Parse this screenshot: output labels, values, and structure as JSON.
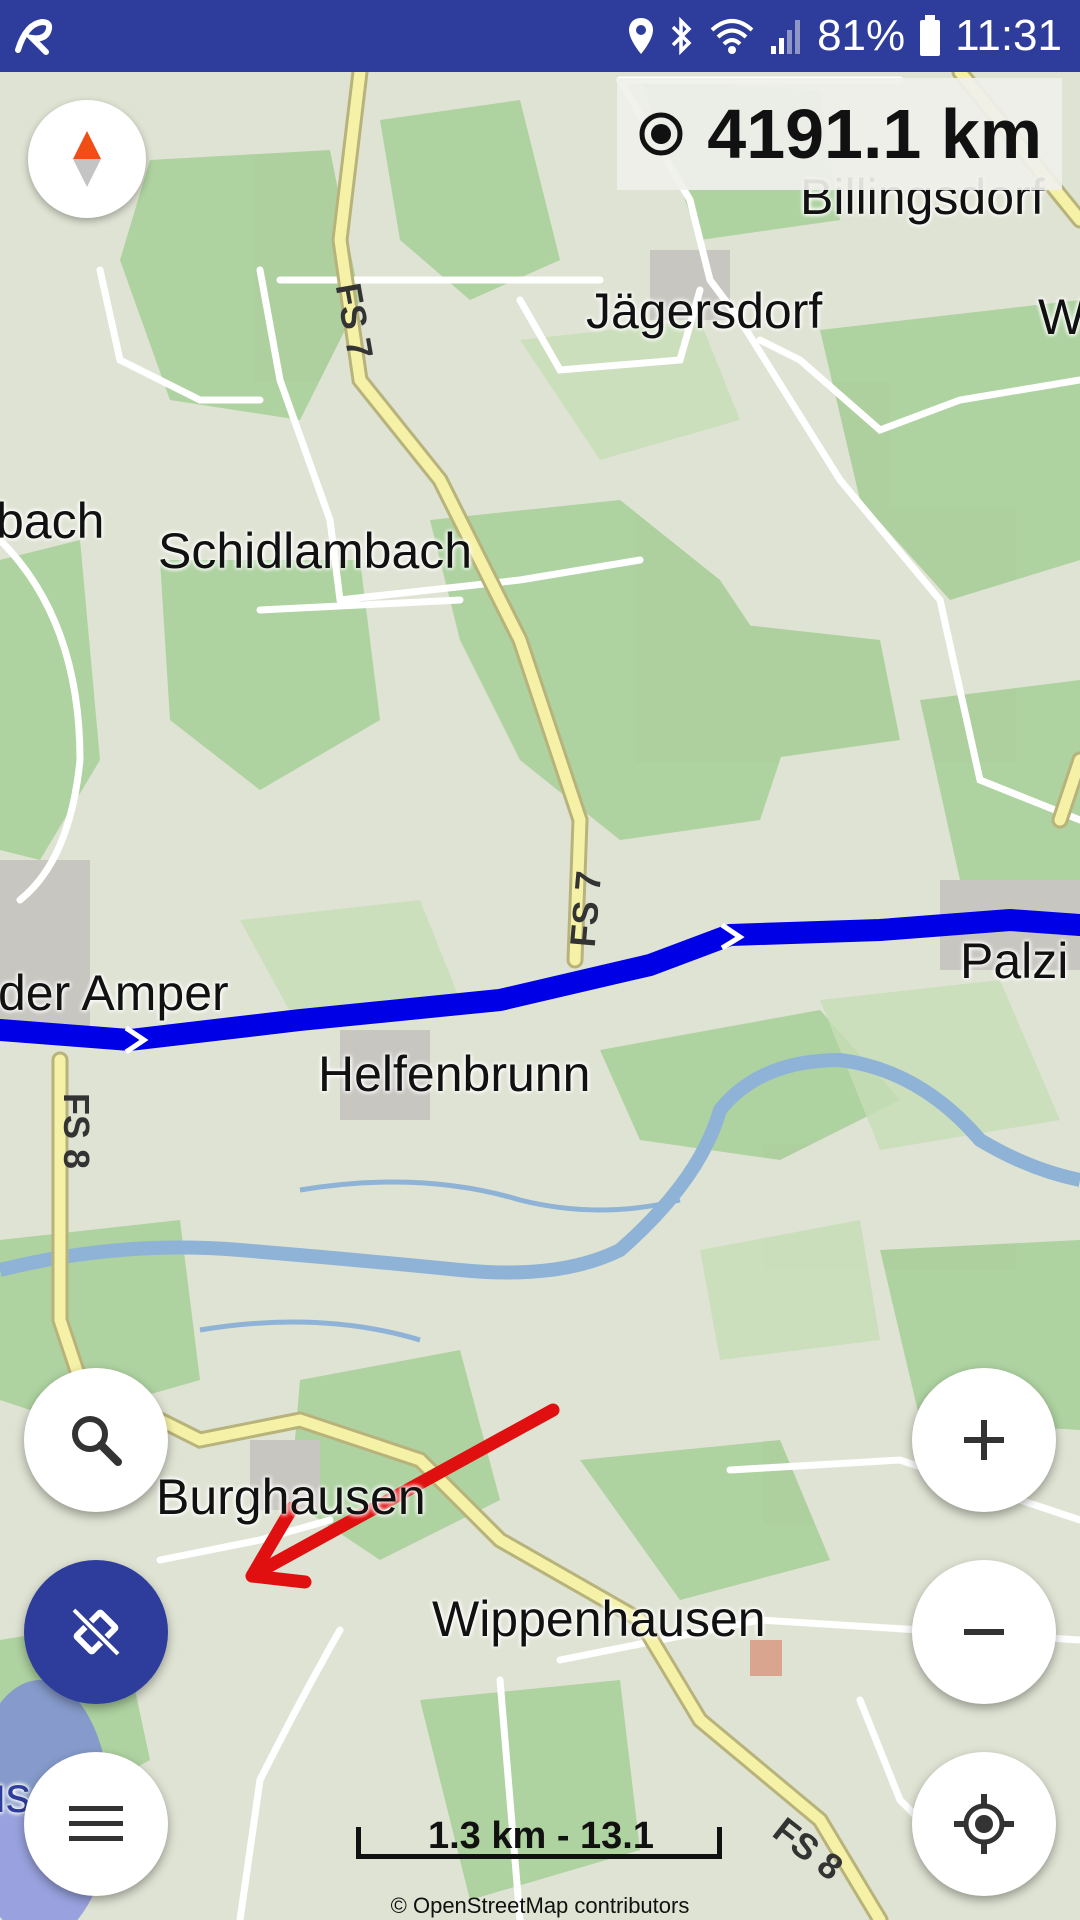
{
  "status_bar": {
    "battery": "81%",
    "time": "11:31"
  },
  "distance": {
    "value": "4191.1 km"
  },
  "places": {
    "billingsdorf": "Billingsdorf",
    "jaegersdorf": "Jägersdorf",
    "w": "W",
    "bach": "bach",
    "schidlambach": "Schidlambach",
    "der_amper": "der Amper",
    "palzi": "Palzi",
    "helfenbrunn": "Helfenbrunn",
    "burghausen": "Burghausen",
    "wippenhausen": "Wippenhausen",
    "us": "us"
  },
  "roads": {
    "fs7_top": "FS 7",
    "fs7_mid": "FS 7",
    "fs8_left": "FS 8",
    "fs8_bottom": "FS 8"
  },
  "scale_bar": {
    "label": "1.3 km - 13.1"
  },
  "attribution": "© OpenStreetMap contributors",
  "icons": {
    "app": "app-logo-icon",
    "location": "location-pin-icon",
    "bluetooth": "bluetooth-icon",
    "wifi": "wifi-icon",
    "signal": "cell-signal-icon",
    "battery": "battery-icon",
    "record": "record-icon",
    "compass": "compass-icon",
    "search": "search-icon",
    "track_off": "track-off-icon",
    "menu": "menu-icon",
    "zoom_in": "plus-icon",
    "zoom_out": "minus-icon",
    "my_location": "my-location-icon"
  },
  "colors": {
    "statusbar": "#2e3d9c",
    "route": "#0000e6",
    "annotation_arrow": "#e01010"
  }
}
